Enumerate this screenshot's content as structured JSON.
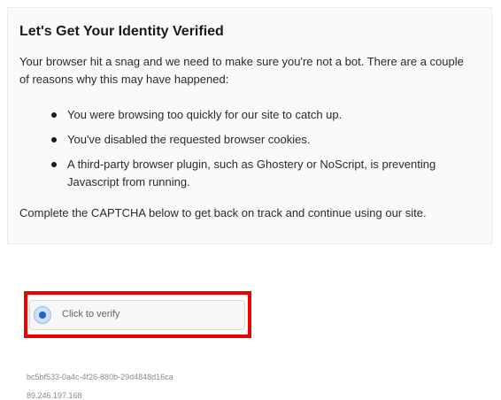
{
  "card": {
    "title": "Let's Get Your Identity Verified",
    "intro": "Your browser hit a snag and we need to make sure you're not a bot. There are a couple of reasons why this may have happened:",
    "reasons": [
      "You were browsing too quickly for our site to catch up.",
      "You've disabled the requested browser cookies.",
      "A third-party browser plugin, such as Ghostery or NoScript, is preventing Javascript from running."
    ],
    "closing": "Complete the CAPTCHA below to get back on track and continue using our site."
  },
  "captcha": {
    "label": "Click to verify",
    "icon": "verify-circle-icon",
    "accent_color": "#1f63d6",
    "highlight_color": "#ee0000"
  },
  "footer": {
    "request_id": "bc5bf533-0a4c-4f26-880b-29d4848d16ca",
    "ip_address": "89.246.197.168"
  }
}
